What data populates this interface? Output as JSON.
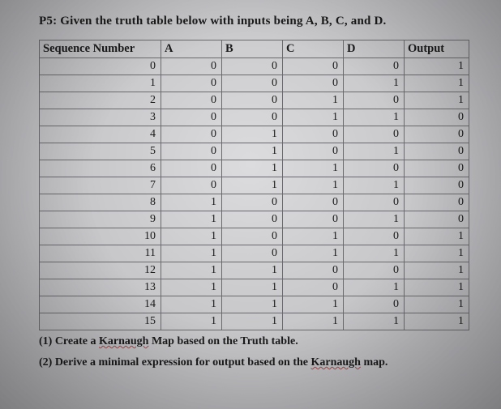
{
  "title_prefix": "P5:",
  "title_rest": " Given the truth table below with inputs being A, B, C, and D.",
  "headers": [
    "Sequence Number",
    "A",
    "B",
    "C",
    "D",
    "Output"
  ],
  "rows": [
    [
      "0",
      "0",
      "0",
      "0",
      "0",
      "1"
    ],
    [
      "1",
      "0",
      "0",
      "0",
      "1",
      "1"
    ],
    [
      "2",
      "0",
      "0",
      "1",
      "0",
      "1"
    ],
    [
      "3",
      "0",
      "0",
      "1",
      "1",
      "0"
    ],
    [
      "4",
      "0",
      "1",
      "0",
      "0",
      "0"
    ],
    [
      "5",
      "0",
      "1",
      "0",
      "1",
      "0"
    ],
    [
      "6",
      "0",
      "1",
      "1",
      "0",
      "0"
    ],
    [
      "7",
      "0",
      "1",
      "1",
      "1",
      "0"
    ],
    [
      "8",
      "1",
      "0",
      "0",
      "0",
      "0"
    ],
    [
      "9",
      "1",
      "0",
      "0",
      "1",
      "0"
    ],
    [
      "10",
      "1",
      "0",
      "1",
      "0",
      "1"
    ],
    [
      "11",
      "1",
      "0",
      "1",
      "1",
      "1"
    ],
    [
      "12",
      "1",
      "1",
      "0",
      "0",
      "1"
    ],
    [
      "13",
      "1",
      "1",
      "0",
      "1",
      "1"
    ],
    [
      "14",
      "1",
      "1",
      "1",
      "0",
      "1"
    ],
    [
      "15",
      "1",
      "1",
      "1",
      "1",
      "1"
    ]
  ],
  "q1_prefix": "(1) Create a ",
  "q1_wavy": "Karnaugh",
  "q1_rest": " Map based on the Truth table.",
  "q2_prefix": "(2) Derive a minimal expression for output based on the ",
  "q2_wavy": "Karnaugh",
  "q2_rest": " map.",
  "chart_data": {
    "type": "table",
    "title": "Truth table with inputs A, B, C, D and Output",
    "columns": [
      "Sequence Number",
      "A",
      "B",
      "C",
      "D",
      "Output"
    ],
    "data": [
      {
        "seq": 0,
        "A": 0,
        "B": 0,
        "C": 0,
        "D": 0,
        "Output": 1
      },
      {
        "seq": 1,
        "A": 0,
        "B": 0,
        "C": 0,
        "D": 1,
        "Output": 1
      },
      {
        "seq": 2,
        "A": 0,
        "B": 0,
        "C": 1,
        "D": 0,
        "Output": 1
      },
      {
        "seq": 3,
        "A": 0,
        "B": 0,
        "C": 1,
        "D": 1,
        "Output": 0
      },
      {
        "seq": 4,
        "A": 0,
        "B": 1,
        "C": 0,
        "D": 0,
        "Output": 0
      },
      {
        "seq": 5,
        "A": 0,
        "B": 1,
        "C": 0,
        "D": 1,
        "Output": 0
      },
      {
        "seq": 6,
        "A": 0,
        "B": 1,
        "C": 1,
        "D": 0,
        "Output": 0
      },
      {
        "seq": 7,
        "A": 0,
        "B": 1,
        "C": 1,
        "D": 1,
        "Output": 0
      },
      {
        "seq": 8,
        "A": 1,
        "B": 0,
        "C": 0,
        "D": 0,
        "Output": 0
      },
      {
        "seq": 9,
        "A": 1,
        "B": 0,
        "C": 0,
        "D": 1,
        "Output": 0
      },
      {
        "seq": 10,
        "A": 1,
        "B": 0,
        "C": 1,
        "D": 0,
        "Output": 1
      },
      {
        "seq": 11,
        "A": 1,
        "B": 0,
        "C": 1,
        "D": 1,
        "Output": 1
      },
      {
        "seq": 12,
        "A": 1,
        "B": 1,
        "C": 0,
        "D": 0,
        "Output": 1
      },
      {
        "seq": 13,
        "A": 1,
        "B": 1,
        "C": 0,
        "D": 1,
        "Output": 1
      },
      {
        "seq": 14,
        "A": 1,
        "B": 1,
        "C": 1,
        "D": 0,
        "Output": 1
      },
      {
        "seq": 15,
        "A": 1,
        "B": 1,
        "C": 1,
        "D": 1,
        "Output": 1
      }
    ]
  }
}
